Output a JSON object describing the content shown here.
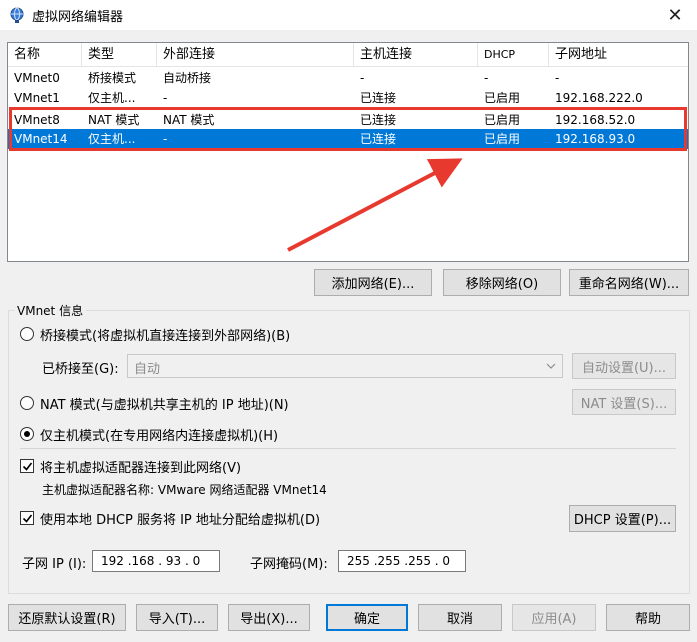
{
  "window": {
    "title": "虚拟网络编辑器",
    "close_symbol": "✕",
    "icon": "globe-network-icon",
    "accent": "#0078d7"
  },
  "list": {
    "headers": [
      "名称",
      "类型",
      "外部连接",
      "主机连接",
      "DHCP",
      "子网地址"
    ],
    "rows": [
      [
        "VMnet0",
        "桥接模式",
        "自动桥接",
        "-",
        "-",
        "-"
      ],
      [
        "VMnet1",
        "仅主机...",
        "-",
        "已连接",
        "已启用",
        "192.168.222.0"
      ],
      [
        "VMnet8",
        "NAT 模式",
        "NAT 模式",
        "已连接",
        "已启用",
        "192.168.52.0"
      ],
      [
        "VMnet14",
        "仅主机...",
        "-",
        "已连接",
        "已启用",
        "192.168.93.0"
      ]
    ],
    "selected_row": 3
  },
  "annotation": {
    "color": "#e8392f"
  },
  "list_buttons": {
    "add": "添加网络(E)...",
    "remove": "移除网络(O)",
    "rename": "重命名网络(W)..."
  },
  "vmnet_info": {
    "title": "VMnet 信息",
    "bridged_label": "桥接模式(将虚拟机直接连接到外部网络)(B)",
    "bridged_to_label": "已桥接至(G):",
    "bridged_to_value": "自动",
    "auto_settings": "自动设置(U)...",
    "nat_label": "NAT 模式(与虚拟机共享主机的 IP 地址)(N)",
    "nat_settings": "NAT 设置(S)...",
    "hostonly_label": "仅主机模式(在专用网络内连接虚拟机)(H)",
    "selected_mode": "hostonly",
    "connect_adapter_label": "将主机虚拟适配器连接到此网络(V)",
    "connect_adapter_checked": true,
    "adapter_name_label": "主机虚拟适配器名称: VMware 网络适配器 VMnet14",
    "dhcp_label": "使用本地 DHCP 服务将 IP 地址分配给虚拟机(D)",
    "dhcp_checked": true,
    "dhcp_settings": "DHCP 设置(P)...",
    "subnet_ip_label": "子网 IP (I):",
    "subnet_ip_value": "192 .168 . 93 . 0",
    "subnet_mask_label": "子网掩码(M):",
    "subnet_mask_value": "255 .255 .255 . 0"
  },
  "footer": {
    "restore": "还原默认设置(R)",
    "import": "导入(T)...",
    "export": "导出(X)...",
    "ok": "确定",
    "cancel": "取消",
    "apply": "应用(A)",
    "help": "帮助"
  }
}
